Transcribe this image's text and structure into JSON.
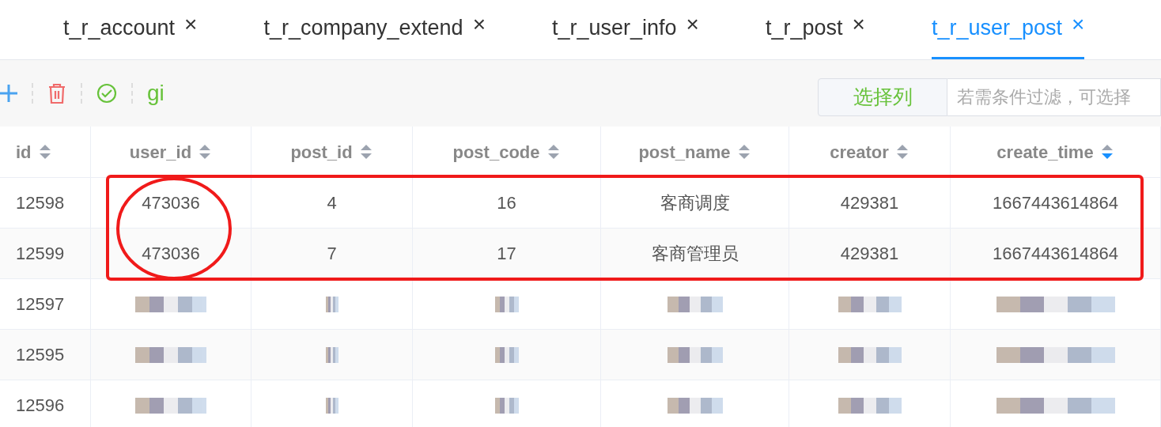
{
  "tabs": [
    {
      "label": "t_r_account",
      "selected": false
    },
    {
      "label": "t_r_company_extend",
      "selected": false
    },
    {
      "label": "t_r_user_info",
      "selected": false
    },
    {
      "label": "t_r_post",
      "selected": false
    },
    {
      "label": "t_r_user_post",
      "selected": true
    }
  ],
  "tab_close": "×",
  "toolbar": {
    "git_label": "gi",
    "select_columns": "选择列",
    "filter": {
      "placeholder": "若需条件过滤，可选择"
    }
  },
  "table": {
    "columns": [
      {
        "label": "id",
        "sorted_descending": false
      },
      {
        "label": "user_id",
        "sorted_descending": false
      },
      {
        "label": "post_id",
        "sorted_descending": false
      },
      {
        "label": "post_code",
        "sorted_descending": false
      },
      {
        "label": "post_name",
        "sorted_descending": false
      },
      {
        "label": "creator",
        "sorted_descending": false
      },
      {
        "label": "create_time",
        "sorted_descending": true
      }
    ],
    "rows": [
      {
        "cells": [
          {
            "kind": "text",
            "text": "12598"
          },
          {
            "kind": "text",
            "text": "473036"
          },
          {
            "kind": "text",
            "text": "4"
          },
          {
            "kind": "text",
            "text": "16"
          },
          {
            "kind": "text",
            "text": "客商调度"
          },
          {
            "kind": "text",
            "text": "429381"
          },
          {
            "kind": "text",
            "text": "1667443614864"
          }
        ]
      },
      {
        "cells": [
          {
            "kind": "text",
            "text": "12599"
          },
          {
            "kind": "text",
            "text": "473036"
          },
          {
            "kind": "text",
            "text": "7"
          },
          {
            "kind": "text",
            "text": "17"
          },
          {
            "kind": "text",
            "text": "客商管理员"
          },
          {
            "kind": "text",
            "text": "429381"
          },
          {
            "kind": "text",
            "text": "1667443614864"
          }
        ]
      },
      {
        "cells": [
          {
            "kind": "text",
            "text": "12597"
          },
          {
            "kind": "redacted"
          },
          {
            "kind": "redacted"
          },
          {
            "kind": "redacted"
          },
          {
            "kind": "redacted"
          },
          {
            "kind": "redacted"
          },
          {
            "kind": "redacted"
          }
        ]
      },
      {
        "cells": [
          {
            "kind": "text",
            "text": "12595"
          },
          {
            "kind": "redacted"
          },
          {
            "kind": "redacted"
          },
          {
            "kind": "redacted"
          },
          {
            "kind": "redacted"
          },
          {
            "kind": "redacted"
          },
          {
            "kind": "redacted"
          }
        ]
      },
      {
        "cells": [
          {
            "kind": "text",
            "text": "12596"
          },
          {
            "kind": "redacted"
          },
          {
            "kind": "redacted"
          },
          {
            "kind": "redacted"
          },
          {
            "kind": "redacted"
          },
          {
            "kind": "redacted"
          },
          {
            "kind": "redacted"
          }
        ]
      }
    ]
  }
}
